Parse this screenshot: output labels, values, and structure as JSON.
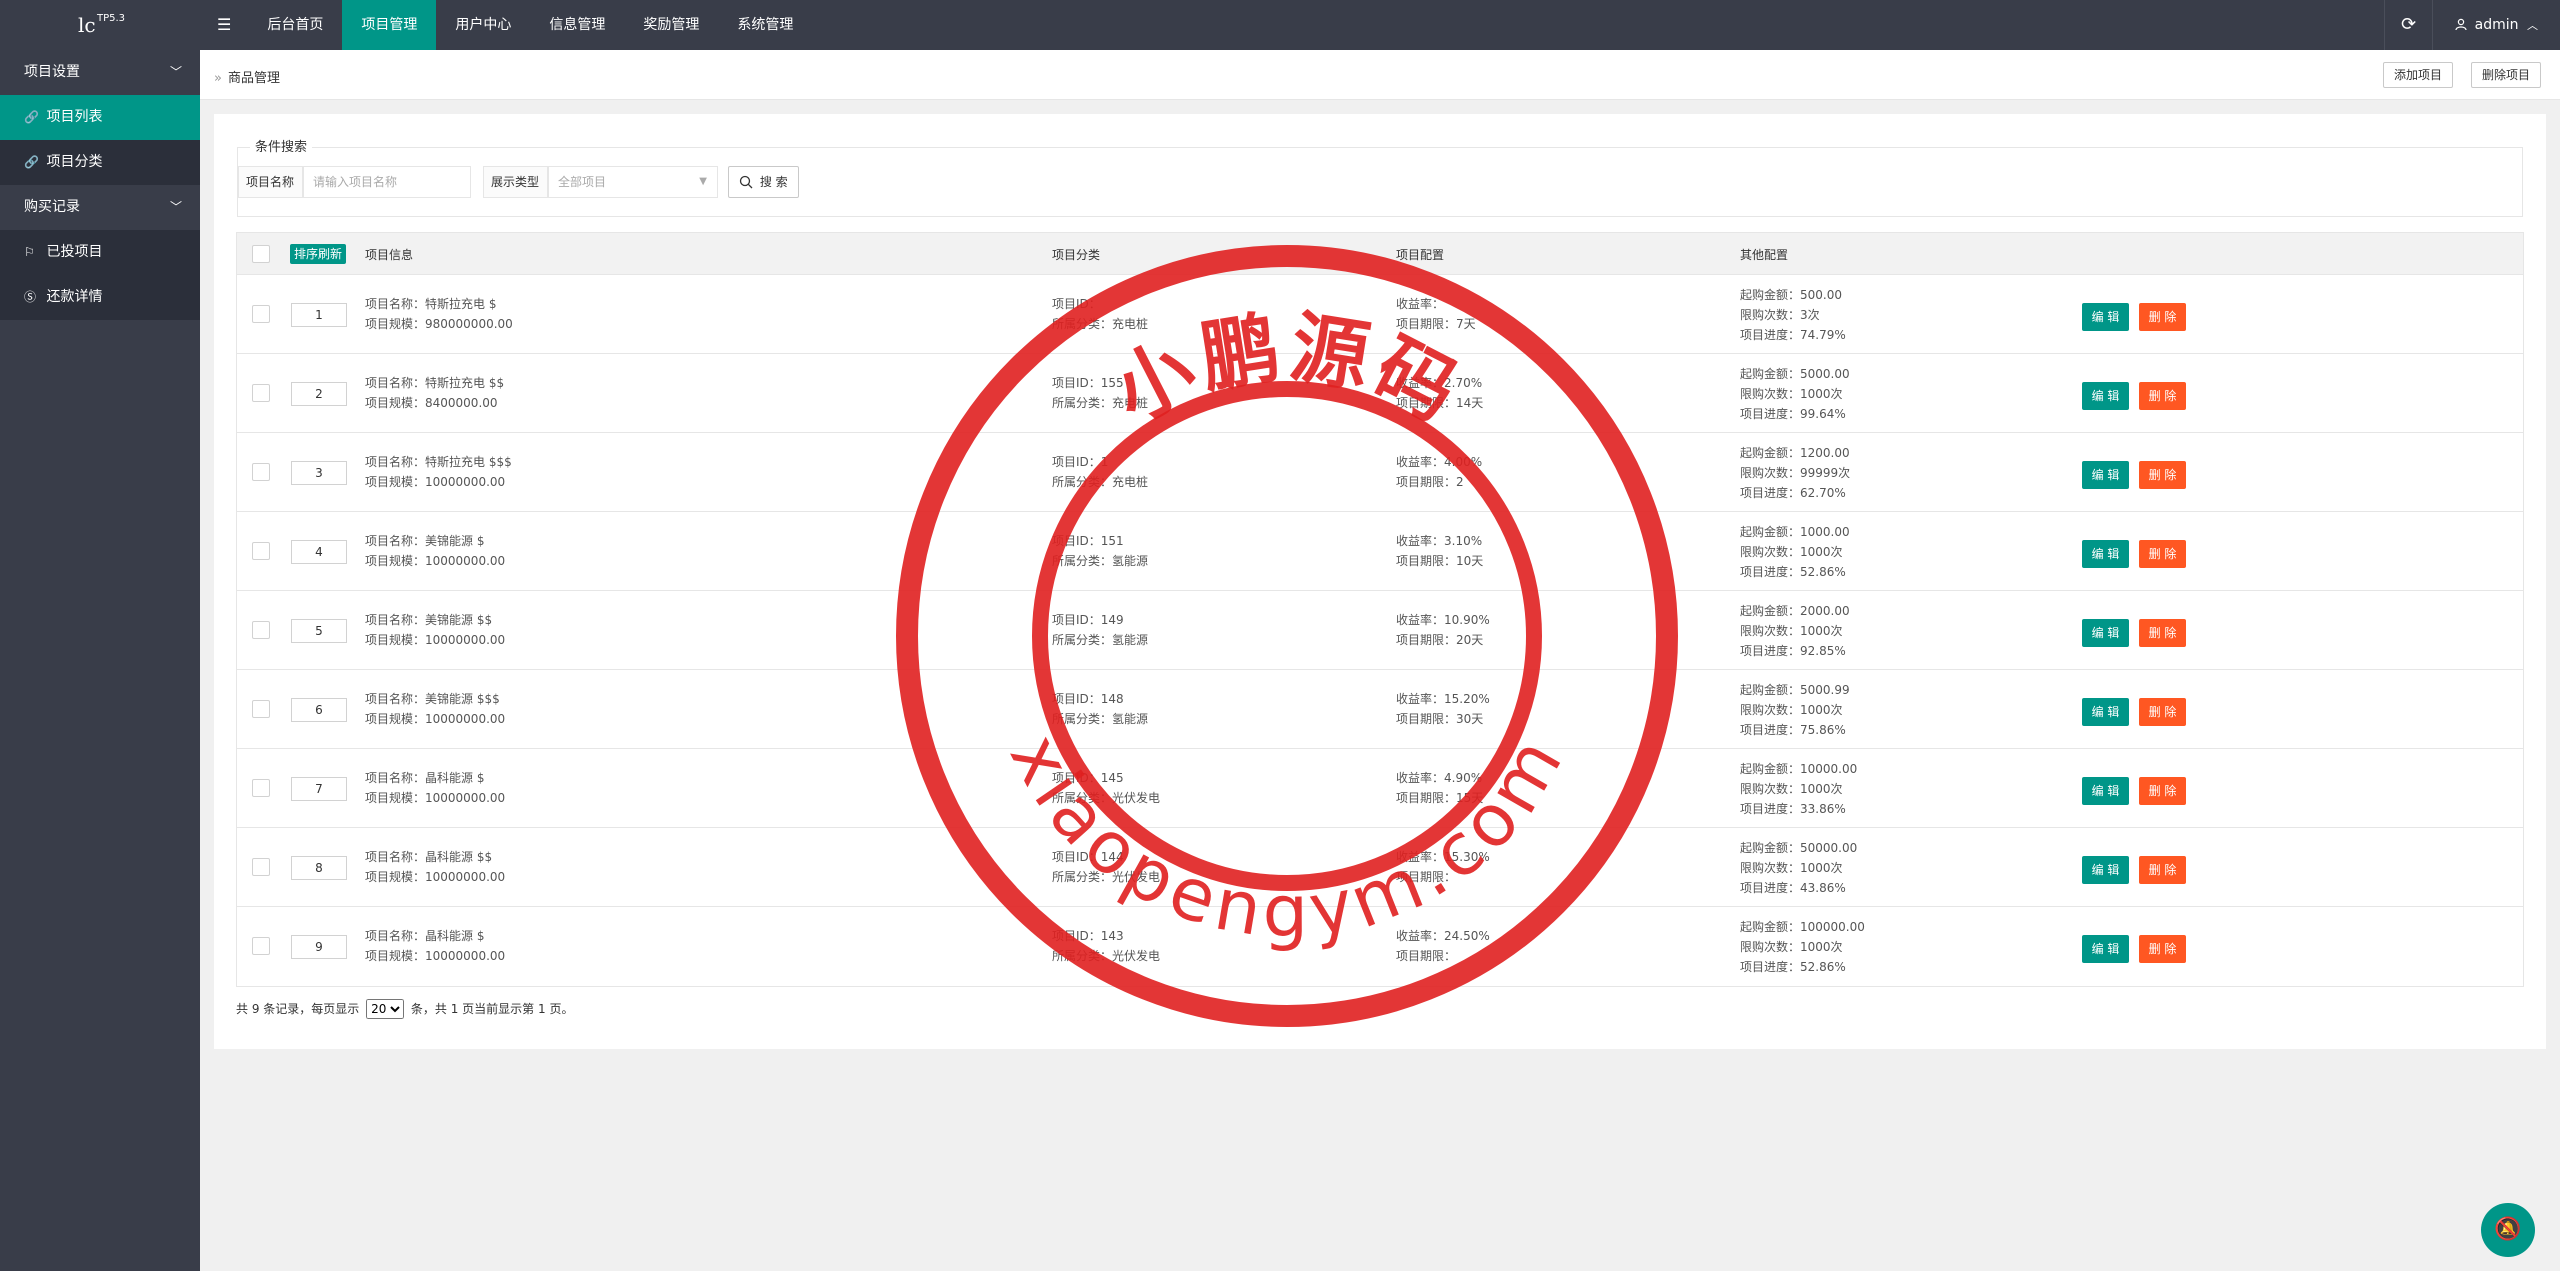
{
  "app": {
    "logo": "lc",
    "version": "TP5.3"
  },
  "nav": {
    "menu_icon": "☰",
    "items": [
      {
        "label": "后台首页",
        "active": false
      },
      {
        "label": "项目管理",
        "active": true
      },
      {
        "label": "用户中心",
        "active": false
      },
      {
        "label": "信息管理",
        "active": false
      },
      {
        "label": "奖励管理",
        "active": false
      },
      {
        "label": "系统管理",
        "active": false
      }
    ],
    "refresh_icon": "⟳",
    "user": "admin"
  },
  "sidebar": {
    "groups": [
      {
        "label": "项目设置",
        "items": [
          {
            "label": "项目列表",
            "icon": "link-icon",
            "active": true
          },
          {
            "label": "项目分类",
            "icon": "link-icon",
            "active": false
          }
        ]
      },
      {
        "label": "购买记录",
        "items": [
          {
            "label": "已投项目",
            "icon": "flag-icon",
            "active": false
          },
          {
            "label": "还款详情",
            "icon": "dollar-icon",
            "active": false
          }
        ]
      }
    ]
  },
  "header": {
    "breadcrumb": "商品管理",
    "add_label": "添加项目",
    "delete_label": "删除项目"
  },
  "search": {
    "legend": "条件搜索",
    "name_label": "项目名称",
    "name_placeholder": "请输入项目名称",
    "type_label": "展示类型",
    "type_value": "全部项目",
    "search_label": "搜 索"
  },
  "table": {
    "sort_label": "排序刷新",
    "headers": [
      "项目信息",
      "项目分类",
      "项目配置",
      "其他配置"
    ],
    "edit_label": "编 辑",
    "delete_label": "删 除",
    "rows": [
      {
        "order": "1",
        "name": "项目名称：特斯拉充电 $",
        "scale": "项目规模：980000000.00",
        "pid": "项目ID：",
        "cat": "所属分类：充电桩",
        "rate": "收益率：",
        "period": "项目期限：7天",
        "min": "起购金额：500.00",
        "limit": "限购次数：3次",
        "progress": "项目进度：74.79%"
      },
      {
        "order": "2",
        "name": "项目名称：特斯拉充电 $$",
        "scale": "项目规模：8400000.00",
        "pid": "项目ID：155",
        "cat": "所属分类：充电桩",
        "rate": "收益率：2.70%",
        "period": "项目期限：14天",
        "min": "起购金额：5000.00",
        "limit": "限购次数：1000次",
        "progress": "项目进度：99.64%"
      },
      {
        "order": "3",
        "name": "项目名称：特斯拉充电 $$$",
        "scale": "项目规模：10000000.00",
        "pid": "项目ID：1",
        "cat": "所属分类：充电桩",
        "rate": "收益率：4.00%",
        "period": "项目期限：2",
        "min": "起购金额：1200.00",
        "limit": "限购次数：99999次",
        "progress": "项目进度：62.70%"
      },
      {
        "order": "4",
        "name": "项目名称：美锦能源 $",
        "scale": "项目规模：10000000.00",
        "pid": "项目ID：151",
        "cat": "所属分类：氢能源",
        "rate": "收益率：3.10%",
        "period": "项目期限：10天",
        "min": "起购金额：1000.00",
        "limit": "限购次数：1000次",
        "progress": "项目进度：52.86%"
      },
      {
        "order": "5",
        "name": "项目名称：美锦能源 $$",
        "scale": "项目规模：10000000.00",
        "pid": "项目ID：149",
        "cat": "所属分类：氢能源",
        "rate": "收益率：10.90%",
        "period": "项目期限：20天",
        "min": "起购金额：2000.00",
        "limit": "限购次数：1000次",
        "progress": "项目进度：92.85%"
      },
      {
        "order": "6",
        "name": "项目名称：美锦能源 $$$",
        "scale": "项目规模：10000000.00",
        "pid": "项目ID：148",
        "cat": "所属分类：氢能源",
        "rate": "收益率：15.20%",
        "period": "项目期限：30天",
        "min": "起购金额：5000.99",
        "limit": "限购次数：1000次",
        "progress": "项目进度：75.86%"
      },
      {
        "order": "7",
        "name": "项目名称：晶科能源 $",
        "scale": "项目规模：10000000.00",
        "pid": "项目ID：145",
        "cat": "所属分类：光伏发电",
        "rate": "收益率：4.90%",
        "period": "项目期限：15天",
        "min": "起购金额：10000.00",
        "limit": "限购次数：1000次",
        "progress": "项目进度：33.86%"
      },
      {
        "order": "8",
        "name": "项目名称：晶科能源 $$",
        "scale": "项目规模：10000000.00",
        "pid": "项目ID：144",
        "cat": "所属分类：光伏发电",
        "rate": "收益率：15.30%",
        "period": "项目期限：",
        "min": "起购金额：50000.00",
        "limit": "限购次数：1000次",
        "progress": "项目进度：43.86%"
      },
      {
        "order": "9",
        "name": "项目名称：晶科能源 $",
        "scale": "项目规模：10000000.00",
        "pid": "项目ID：143",
        "cat": "所属分类：光伏发电",
        "rate": "收益率：24.50%",
        "period": "项目期限：",
        "min": "起购金额：100000.00",
        "limit": "限购次数：1000次",
        "progress": "项目进度：52.86%"
      }
    ]
  },
  "pager": {
    "prefix": "共 9 条记录，每页显示",
    "page_size": "20",
    "suffix": "条，共 1 页当前显示第 1 页。"
  },
  "watermark": {
    "cn": "小鹏源码",
    "url": "xiaopengym.com",
    "color": "#e02020"
  },
  "accent": "#009688",
  "danger": "#ff5722"
}
